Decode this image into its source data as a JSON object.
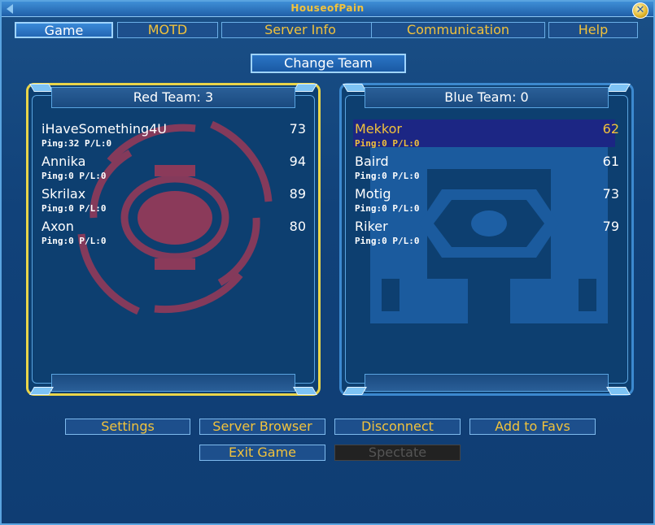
{
  "window": {
    "title": "HouseofPain"
  },
  "tabs": [
    {
      "label": "Game",
      "active": true
    },
    {
      "label": "MOTD",
      "active": false
    },
    {
      "label": "Server Info",
      "active": false
    },
    {
      "label": "Communication",
      "active": false
    },
    {
      "label": "Help",
      "active": false
    }
  ],
  "change_team_label": "Change Team",
  "red_team": {
    "header": "Red Team: 3",
    "players": [
      {
        "name": "iHaveSomething4U",
        "score": "73",
        "ping": "Ping:32 P/L:0"
      },
      {
        "name": "Annika",
        "score": "94",
        "ping": "Ping:0 P/L:0"
      },
      {
        "name": "Skrilax",
        "score": "89",
        "ping": "Ping:0 P/L:0"
      },
      {
        "name": "Axon",
        "score": "80",
        "ping": "Ping:0 P/L:0"
      }
    ]
  },
  "blue_team": {
    "header": "Blue Team: 0",
    "players": [
      {
        "name": "Mekkor",
        "score": "62",
        "ping": "Ping:0 P/L:0",
        "selected": true
      },
      {
        "name": "Baird",
        "score": "61",
        "ping": "Ping:0 P/L:0"
      },
      {
        "name": "Motig",
        "score": "73",
        "ping": "Ping:0 P/L:0"
      },
      {
        "name": "Riker",
        "score": "79",
        "ping": "Ping:0 P/L:0"
      }
    ]
  },
  "buttons": {
    "settings": "Settings",
    "server_browser": "Server Browser",
    "disconnect": "Disconnect",
    "add_to_favs": "Add to Favs",
    "exit_game": "Exit Game",
    "spectate": "Spectate"
  },
  "colors": {
    "accent_text": "#f1c23c",
    "selection": "#1c2684",
    "red_emblem": "#8b3a5a",
    "blue_emblem": "#1d5fa4"
  }
}
